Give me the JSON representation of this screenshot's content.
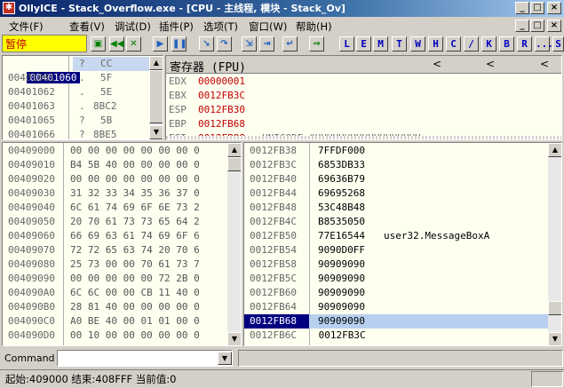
{
  "window": {
    "title": "OllyICE - Stack_Overflow.exe - [CPU - 主线程, 模块 - Stack_Ov]",
    "app_icon": "bug-icon",
    "buttons": {
      "minimize": "_",
      "restore": "□",
      "close": "×"
    },
    "inner_buttons": {
      "minimize": "_",
      "restore": "□",
      "close": "×"
    }
  },
  "menu": [
    "文件(F)",
    "查看(V)",
    "调试(D)",
    "插件(P)",
    "选项(T)",
    "窗口(W)",
    "帮助(H)"
  ],
  "toolbar": {
    "status": "暂停",
    "status_color": "#ffff00",
    "buttons": [
      "open",
      "rewind",
      "close-proc",
      "run",
      "pause",
      "step-into",
      "step-over",
      "trace-into",
      "trace-over",
      "execute-till-return",
      "goto"
    ],
    "letters": [
      "L",
      "E",
      "M",
      "T",
      "W",
      "H",
      "C",
      "/",
      "K",
      "B",
      "R",
      "...",
      "S"
    ]
  },
  "disasm": {
    "rows": [
      {
        "addr": "00401060",
        "mark": "?",
        "code": "CC"
      },
      {
        "addr": "00401061",
        "mark": ".",
        "code": "5F"
      },
      {
        "addr": "00401062",
        "mark": ".",
        "code": "5E"
      },
      {
        "addr": "00401063",
        "mark": ".",
        "code": "8BC2"
      },
      {
        "addr": "00401065",
        "mark": "?",
        "code": "5B"
      },
      {
        "addr": "00401066",
        "mark": "?",
        "code": "8BE5"
      }
    ]
  },
  "registers": {
    "header": "寄存器 (FPU)",
    "nav": [
      "<",
      "<",
      "<"
    ],
    "rows": [
      {
        "name": "EDX",
        "value": "00000001",
        "comment": ""
      },
      {
        "name": "EBX",
        "value": "0012FB3C",
        "comment": ""
      },
      {
        "name": "ESP",
        "value": "0012FB30",
        "comment": ""
      },
      {
        "name": "EBP",
        "value": "0012FB68",
        "comment": ""
      },
      {
        "name": "ESI",
        "value": "0012FB88",
        "comment": "UNICODE \"HHHHHHHHHHHHHHHHHH"
      }
    ]
  },
  "dump": {
    "rows": [
      {
        "addr": "00409000",
        "hex": "00 00 00 00 00 00 00 0"
      },
      {
        "addr": "00409010",
        "hex": "B4 5B 40 00 00 00 00 0"
      },
      {
        "addr": "00409020",
        "hex": "00 00 00 00 00 00 00 0"
      },
      {
        "addr": "00409030",
        "hex": "31 32 33 34 35 36 37 0"
      },
      {
        "addr": "00409040",
        "hex": "6C 61 74 69 6F 6E 73 2"
      },
      {
        "addr": "00409050",
        "hex": "20 70 61 73 73 65 64 2"
      },
      {
        "addr": "00409060",
        "hex": "66 69 63 61 74 69 6F 6"
      },
      {
        "addr": "00409070",
        "hex": "72 72 65 63 74 20 70 6"
      },
      {
        "addr": "00409080",
        "hex": "25 73 00 00 70 61 73 7"
      },
      {
        "addr": "00409090",
        "hex": "00 00 00 00 00 72 2B 0"
      },
      {
        "addr": "004090A0",
        "hex": "6C 6C 00 00 CB 11 40 0"
      },
      {
        "addr": "004090B0",
        "hex": "28 81 40 00 00 00 00 0"
      },
      {
        "addr": "004090C0",
        "hex": "A0 BE 40 00 01 01 00 0"
      },
      {
        "addr": "004090D0",
        "hex": "00 10 00 00 00 00 00 0"
      }
    ]
  },
  "stack": {
    "selected_index": 12,
    "rows": [
      {
        "addr": "0012FB38",
        "value": "7FFDF000",
        "comment": ""
      },
      {
        "addr": "0012FB3C",
        "value": "6853DB33",
        "comment": ""
      },
      {
        "addr": "0012FB40",
        "value": "69636B79",
        "comment": ""
      },
      {
        "addr": "0012FB44",
        "value": "69695268",
        "comment": ""
      },
      {
        "addr": "0012FB48",
        "value": "53C48B48",
        "comment": ""
      },
      {
        "addr": "0012FB4C",
        "value": "B8535050",
        "comment": ""
      },
      {
        "addr": "0012FB50",
        "value": "77E16544",
        "comment": "user32.MessageBoxA"
      },
      {
        "addr": "0012FB54",
        "value": "9090D0FF",
        "comment": ""
      },
      {
        "addr": "0012FB58",
        "value": "90909090",
        "comment": ""
      },
      {
        "addr": "0012FB5C",
        "value": "90909090",
        "comment": ""
      },
      {
        "addr": "0012FB60",
        "value": "90909090",
        "comment": ""
      },
      {
        "addr": "0012FB64",
        "value": "90909090",
        "comment": ""
      },
      {
        "addr": "0012FB68",
        "value": "90909090",
        "comment": ""
      },
      {
        "addr": "0012FB6C",
        "value": " 0012FB3C",
        "comment": ""
      }
    ]
  },
  "command": {
    "label": "Command",
    "value": ""
  },
  "statusbar": {
    "text": "起始:409000 结束:408FFF 当前值:0"
  }
}
